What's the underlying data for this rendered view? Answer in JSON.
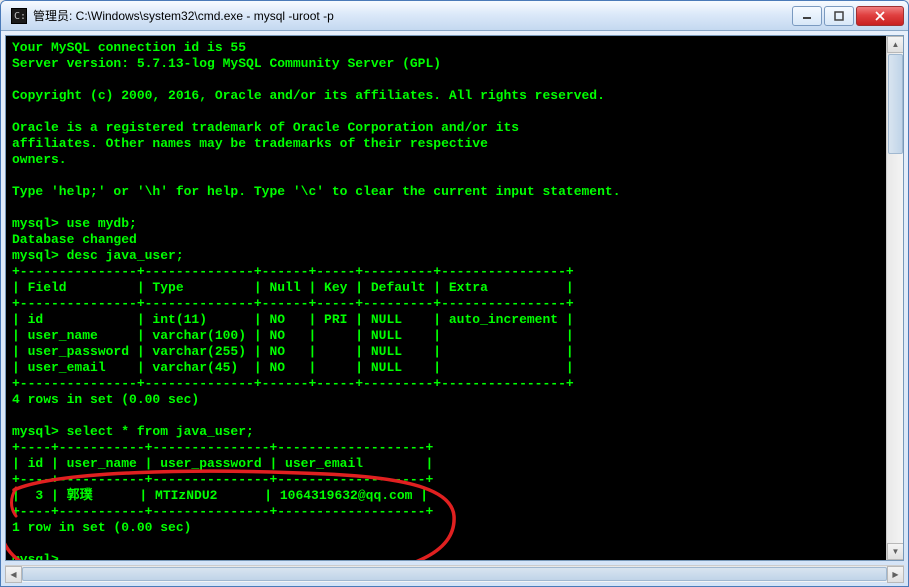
{
  "window": {
    "title": "管理员: C:\\Windows\\system32\\cmd.exe - mysql  -uroot -p"
  },
  "terminal": {
    "lines": [
      "Your MySQL connection id is 55",
      "Server version: 5.7.13-log MySQL Community Server (GPL)",
      "",
      "Copyright (c) 2000, 2016, Oracle and/or its affiliates. All rights reserved.",
      "",
      "Oracle is a registered trademark of Oracle Corporation and/or its",
      "affiliates. Other names may be trademarks of their respective",
      "owners.",
      "",
      "Type 'help;' or '\\h' for help. Type '\\c' to clear the current input statement.",
      "",
      "mysql> use mydb;",
      "Database changed",
      "mysql> desc java_user;",
      "+---------------+--------------+------+-----+---------+----------------+",
      "| Field         | Type         | Null | Key | Default | Extra          |",
      "+---------------+--------------+------+-----+---------+----------------+",
      "| id            | int(11)      | NO   | PRI | NULL    | auto_increment |",
      "| user_name     | varchar(100) | NO   |     | NULL    |                |",
      "| user_password | varchar(255) | NO   |     | NULL    |                |",
      "| user_email    | varchar(45)  | NO   |     | NULL    |                |",
      "+---------------+--------------+------+-----+---------+----------------+",
      "4 rows in set (0.00 sec)",
      "",
      "mysql> select * from java_user;",
      "+----+-----------+---------------+-------------------+",
      "| id | user_name | user_password | user_email        |",
      "+----+-----------+---------------+-------------------+",
      "|  3 | 郭璞      | MTIzNDU2      | 1064319632@qq.com |",
      "+----+-----------+---------------+-------------------+",
      "1 row in set (0.00 sec)",
      "",
      "mysql> "
    ]
  },
  "chart_data": {
    "type": "table",
    "tables": [
      {
        "name": "desc java_user",
        "columns": [
          "Field",
          "Type",
          "Null",
          "Key",
          "Default",
          "Extra"
        ],
        "rows": [
          [
            "id",
            "int(11)",
            "NO",
            "PRI",
            "NULL",
            "auto_increment"
          ],
          [
            "user_name",
            "varchar(100)",
            "NO",
            "",
            "NULL",
            ""
          ],
          [
            "user_password",
            "varchar(255)",
            "NO",
            "",
            "NULL",
            ""
          ],
          [
            "user_email",
            "varchar(45)",
            "NO",
            "",
            "NULL",
            ""
          ]
        ],
        "footer": "4 rows in set (0.00 sec)"
      },
      {
        "name": "select * from java_user",
        "columns": [
          "id",
          "user_name",
          "user_password",
          "user_email"
        ],
        "rows": [
          [
            "3",
            "郭璞",
            "MTIzNDU2",
            "1064319632@qq.com"
          ]
        ],
        "footer": "1 row in set (0.00 sec)"
      }
    ]
  }
}
